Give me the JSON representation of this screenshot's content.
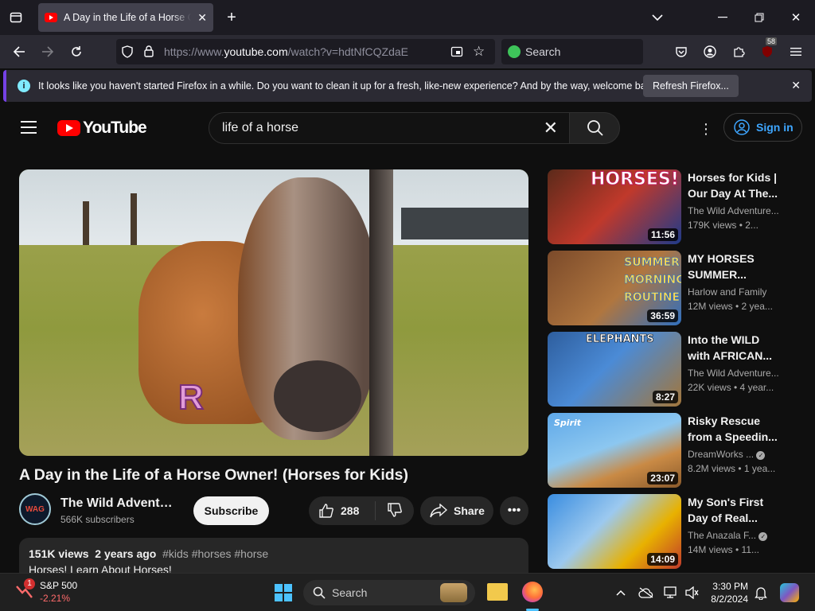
{
  "browser": {
    "tab_title": "A Day in the Life of a Horse Own",
    "url_prefix": "https://www.",
    "url_domain": "youtube.com",
    "url_path": "/watch?v=hdtNfCQZdaE",
    "search_placeholder": "Search",
    "extension_badge": "58"
  },
  "notification": {
    "info_glyph": "i",
    "message": "It looks like you haven't started Firefox in a while. Do you want to clean it up for a fresh, like-new experience? And by the way, welcome back!",
    "button_label": "Refresh Firefox..."
  },
  "youtube": {
    "logo_text": "YouTube",
    "search_query": "life of a horse",
    "sign_in_label": "Sign in",
    "video": {
      "title": "A Day in the Life of a Horse Owner! (Horses for Kids)",
      "overlay_letter": "R",
      "channel_name": "The Wild Adventure Girls",
      "channel_badge": "WAG",
      "subscribers": "566K subscribers",
      "subscribe_label": "Subscribe",
      "likes": "288",
      "share_label": "Share",
      "views": "151K views",
      "age": "2 years ago",
      "tags": "#kids #horses #horse",
      "description_line": "Horses! Learn About Horses!"
    },
    "recommendations": [
      {
        "title": "Horses for Kids | Our Day At The...",
        "channel": "The Wild Adventure...",
        "meta": "179K views • 2...",
        "duration": "11:56",
        "thumb_text": "HORSES!"
      },
      {
        "title": "MY HORSES SUMMER...",
        "channel": "Harlow and Family",
        "meta": "12M views • 2 yea...",
        "duration": "36:59",
        "thumb_text": "SUMMER MORNING ROUTINE"
      },
      {
        "title": "Into the WILD with AFRICAN...",
        "channel": "The Wild Adventure...",
        "meta": "22K views • 4 year...",
        "duration": "8:27",
        "thumb_text": "ELEPHANTS"
      },
      {
        "title": "Risky Rescue from a Speedin...",
        "channel": "DreamWorks ...",
        "meta": "8.2M views • 1 yea...",
        "duration": "23:07",
        "thumb_text": "Spirit"
      },
      {
        "title": "My Son's First Day of Real...",
        "channel": "The Anazala F...",
        "meta": "14M views • 11...",
        "duration": "14:09",
        "thumb_text": ""
      }
    ]
  },
  "taskbar": {
    "stock_name": "S&P 500",
    "stock_change": "-2.21%",
    "stock_alert": "1",
    "search_label": "Search",
    "time": "3:30 PM",
    "date": "8/2/2024"
  },
  "colors": {
    "youtube_red": "#ff0000",
    "link_blue": "#3ea6ff",
    "firefox_accent": "#7542e5",
    "stock_negative": "#ff6b6b"
  }
}
